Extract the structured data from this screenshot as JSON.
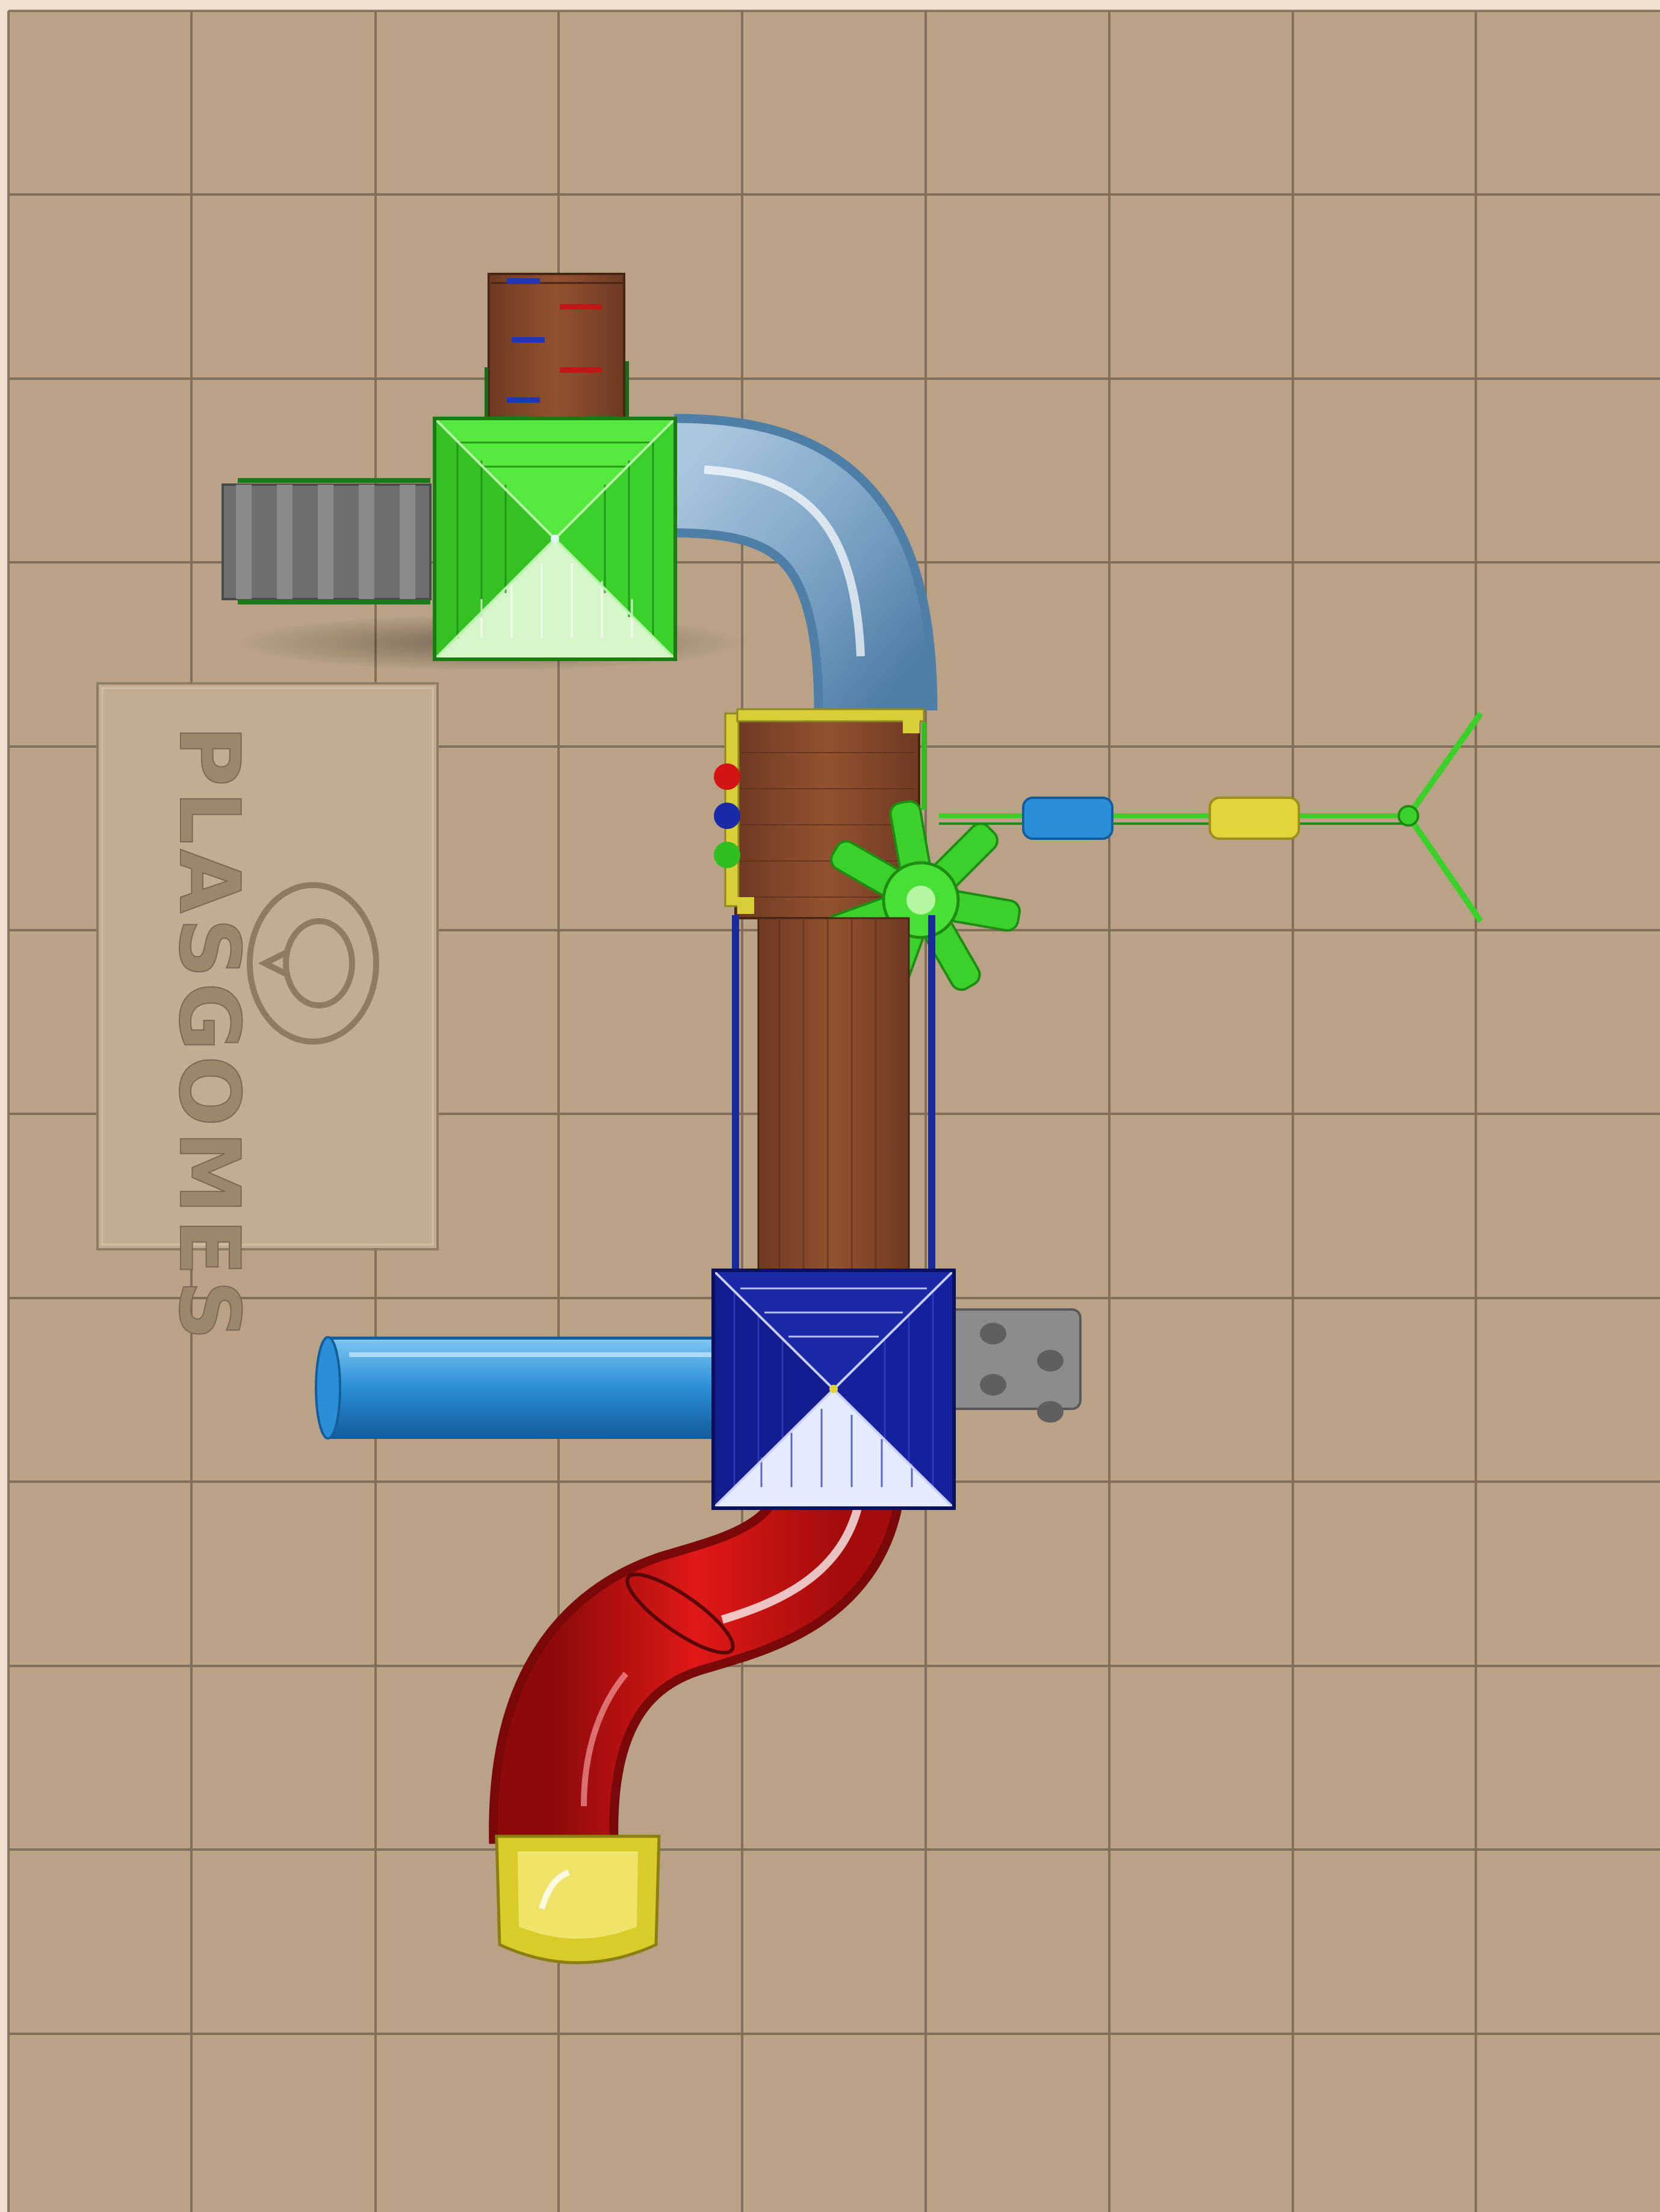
{
  "scene": {
    "subject": "playground-structure-top-view",
    "colors": {
      "frame": "#efe0d2",
      "floor": "#b9a286",
      "floor_grid": "#6f5f4c",
      "green_roof": "#3cd12a",
      "blue_roof": "#14209c",
      "red_slide": "#d21414",
      "yellow": "#e2d43a",
      "light_blue_tube": "#7fa6c8",
      "blue_tube": "#2a8fd6",
      "wood": "#8a4a2c",
      "frame_blue": "#1a2a9a",
      "grey": "#7a7a7a"
    }
  },
  "logo": {
    "brand": "PLASGOMES",
    "icon": "plasgomes-logo-icon"
  }
}
